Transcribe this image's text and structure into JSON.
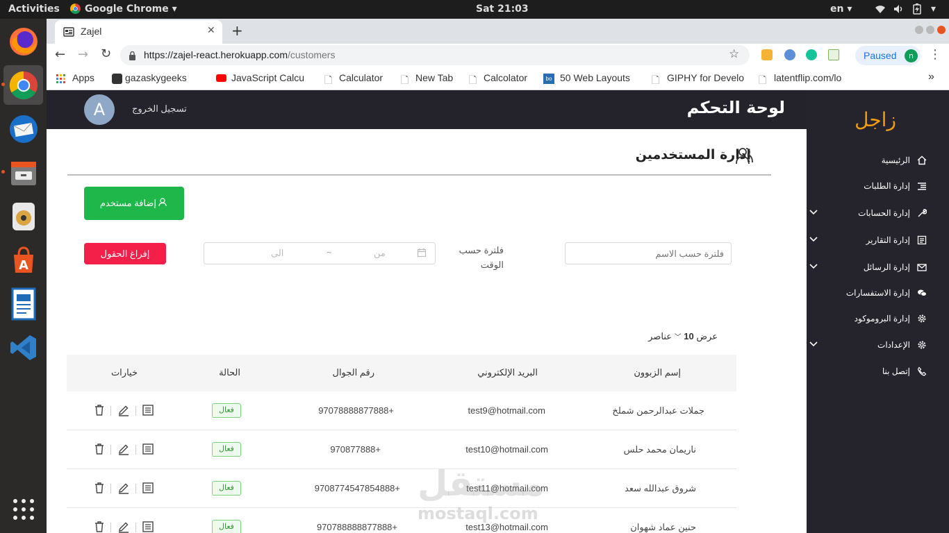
{
  "os": {
    "activities": "Activities",
    "app_name": "Google Chrome",
    "clock": "Sat 21:03",
    "lang": "en"
  },
  "browser": {
    "tab_title": "Zajel",
    "url_host": "https://zajel-react.herokuapp.com",
    "url_path": "/customers",
    "profile_status": "Paused",
    "profile_initial": "n",
    "bookmarks": [
      "Apps",
      "gazaskygeeks",
      "JavaScript Calcu",
      "Calculator",
      "New Tab",
      "Calcolator",
      "50 Web Layouts",
      "GIPHY for Develo",
      "latentflip.com/lo"
    ],
    "more_label": "»"
  },
  "header": {
    "title": "لوحة التحكم",
    "logout": "تسجيل الخروج",
    "avatar": "A"
  },
  "sidebar": {
    "brand": "زاجل",
    "items": [
      {
        "label": "الرئيسية",
        "icon": "home-icon"
      },
      {
        "label": "إدارة الطلبات",
        "icon": "list-icon"
      },
      {
        "label": "إدارة الحسابات",
        "icon": "wrench-icon"
      },
      {
        "label": "إدارة التقارير",
        "icon": "report-icon"
      },
      {
        "label": "إدارة الرسائل",
        "icon": "mail-icon"
      },
      {
        "label": "إدارة الاستفسارات",
        "icon": "chat-icon"
      },
      {
        "label": "إدارة البروموكود",
        "icon": "gear-icon"
      },
      {
        "label": "الإعدادات",
        "icon": "gear-icon"
      },
      {
        "label": "إتصل بنا",
        "icon": "phone-icon"
      }
    ]
  },
  "main": {
    "section_title": "إدارة المستخدمين",
    "add_user_button": "إضافة مستخدم",
    "name_filter_placeholder": "فلترة حسب الاسم",
    "time_filter_label": "فلترة حسب الوقت",
    "date_from": "من",
    "date_separator": "~",
    "date_to": "الى",
    "clear_button": "إفراغ الحقول",
    "page_size_prefix": "عرض",
    "page_size_value": "10",
    "page_size_suffix": "عناصر",
    "columns": [
      "إسم الزبوون",
      "البريد الإلكتروني",
      "رقم الجوال",
      "الحالة",
      "خيارات"
    ],
    "rows": [
      {
        "name": "جملات عبدالرحمن شملخ",
        "email": "test9@hotmail.com",
        "phone": "97078888877888+",
        "status": "فعال"
      },
      {
        "name": "ناريمان محمد حلس",
        "email": "test10@hotmail.com",
        "phone": "970877888+",
        "status": "فعال"
      },
      {
        "name": "شروق عبدالله سعد",
        "email": "test11@hotmail.com",
        "phone": "9708774547854888+",
        "status": "فعال"
      },
      {
        "name": "حنين عماد شهوان",
        "email": "test13@hotmail.com",
        "phone": "970788888877888+",
        "status": "فعال"
      }
    ]
  },
  "watermark": {
    "arabic": "مستقل",
    "latin": "mostaql.com"
  },
  "colors": {
    "dark": "#24222a",
    "accent_orange": "#f39c12",
    "green": "#1fb74a",
    "red": "#f5204a"
  }
}
